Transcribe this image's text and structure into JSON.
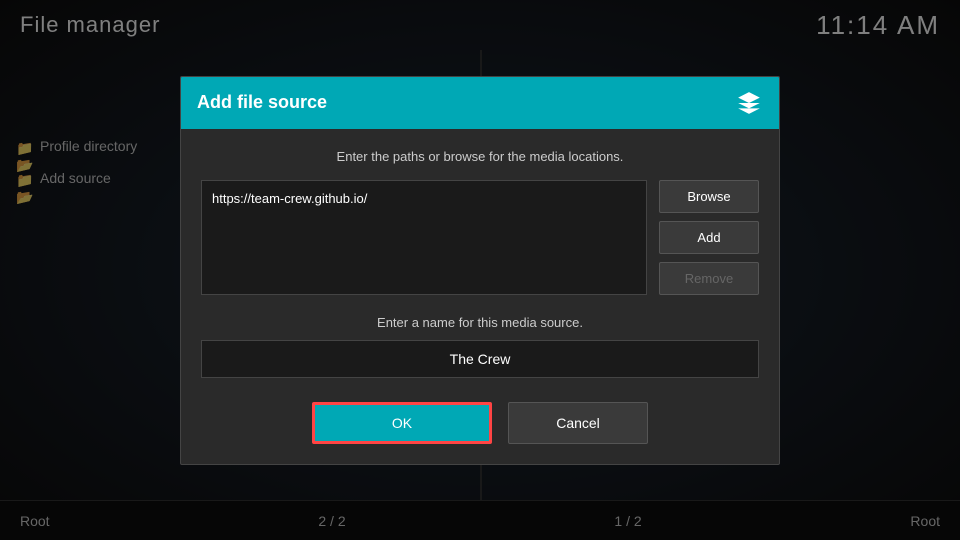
{
  "header": {
    "title": "File manager",
    "clock": "11:14 AM"
  },
  "sidebar": {
    "items": [
      {
        "label": "Profile directory",
        "icon": "folder-icon"
      },
      {
        "label": "Add source",
        "icon": "folder-icon"
      }
    ]
  },
  "bottom": {
    "left_label": "Root",
    "left_page": "2 / 2",
    "right_page": "1 / 2",
    "right_label": "Root"
  },
  "dialog": {
    "title": "Add file source",
    "description": "Enter the paths or browse for the media locations.",
    "source_url": "https://team-crew.github.io/",
    "name_label": "Enter a name for this media source.",
    "name_value": "The Crew",
    "buttons": {
      "browse": "Browse",
      "add": "Add",
      "remove": "Remove",
      "ok": "OK",
      "cancel": "Cancel"
    }
  }
}
